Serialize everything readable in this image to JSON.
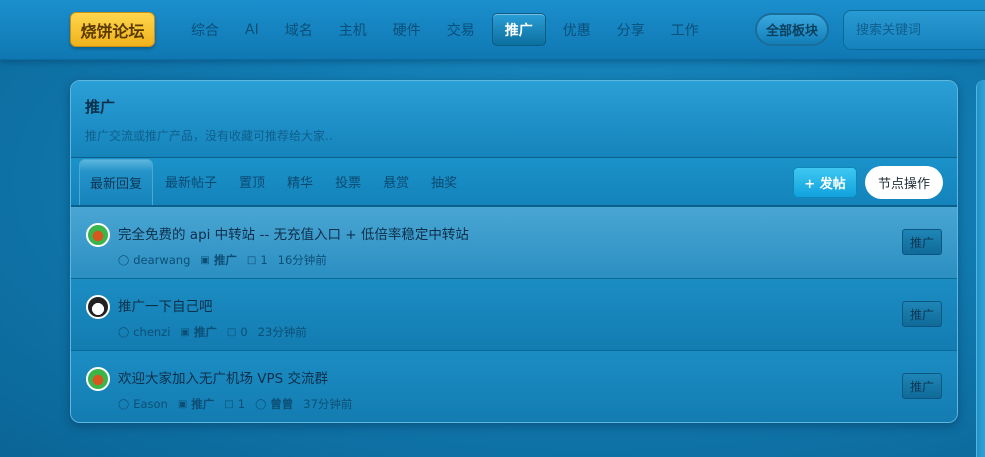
{
  "header": {
    "logo": "烧饼论坛",
    "nav": [
      {
        "label": "综合",
        "active": false
      },
      {
        "label": "AI",
        "active": false
      },
      {
        "label": "域名",
        "active": false
      },
      {
        "label": "主机",
        "active": false
      },
      {
        "label": "硬件",
        "active": false
      },
      {
        "label": "交易",
        "active": false
      },
      {
        "label": "推广",
        "active": true
      },
      {
        "label": "优惠",
        "active": false
      },
      {
        "label": "分享",
        "active": false
      },
      {
        "label": "工作",
        "active": false
      }
    ],
    "all_nodes_label": "全部板块",
    "search_placeholder": "搜索关键词"
  },
  "panel": {
    "title": "推广",
    "description": "推广交流或推广产品，没有收藏可推荐给大家..",
    "tabs": [
      {
        "label": "最新回复",
        "active": true
      },
      {
        "label": "最新帖子",
        "active": false
      },
      {
        "label": "置顶",
        "active": false
      },
      {
        "label": "精华",
        "active": false
      },
      {
        "label": "投票",
        "active": false
      },
      {
        "label": "悬赏",
        "active": false
      },
      {
        "label": "抽奖",
        "active": false
      }
    ],
    "post_button": "+ 发帖",
    "node_ops_button": "节点操作"
  },
  "topics": [
    {
      "title": "完全免费的 api 中转站 -- 无充值入口 + 低倍率稳定中转站",
      "author": "dearwang",
      "node": "推广",
      "replies": "1",
      "time": "16分钟前",
      "last_reply": "",
      "tag": "推广",
      "avatar": "green"
    },
    {
      "title": "推广一下自己吧",
      "author": "chenzi",
      "node": "推广",
      "replies": "0",
      "time": "23分钟前",
      "last_reply": "",
      "tag": "推广",
      "avatar": "panda"
    },
    {
      "title": "欢迎大家加入无广机场 VPS 交流群",
      "author": "Eason",
      "node": "推广",
      "replies": "1",
      "time": "37分钟前",
      "last_reply": "曾曾",
      "tag": "推广",
      "avatar": "green"
    }
  ]
}
